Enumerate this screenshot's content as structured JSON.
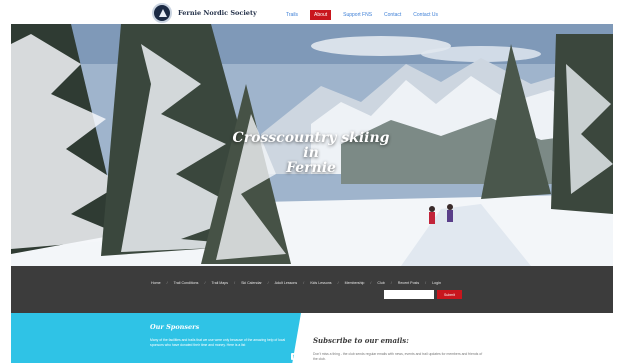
{
  "header": {
    "site_name": "Fernie Nordic Society",
    "nav": [
      {
        "label": "Trails",
        "active": false
      },
      {
        "label": "About",
        "active": true
      },
      {
        "label": "Support FNS",
        "active": false
      },
      {
        "label": "Contact",
        "active": false
      },
      {
        "label": "Contact Us",
        "active": false
      }
    ]
  },
  "hero": {
    "title_line1": "Crosscountry skiing in",
    "title_line2": "Fernie"
  },
  "menubar": {
    "links": [
      "Home",
      "Trail Conditions",
      "Trail Maps",
      "Ski Calendar",
      "Adult Lessons",
      "Kids Lessons",
      "Membership",
      "Club",
      "Recent Posts",
      "Login"
    ],
    "search_placeholder": "",
    "search_button": "Submit"
  },
  "sponsors": {
    "heading": "Our Sponsers",
    "text": "Many of the facilities and trails that we use were only because of the amazing help of local sponsors who have donated their time and money. Here is a list"
  },
  "subscribe": {
    "heading": "Subscribe to our emails:",
    "text": "Don't miss a thing - the club sends regular emails with news, events and trail updates for members and friends of the club."
  },
  "colors": {
    "accent_red": "#c8161d",
    "nav_blue": "#3d7fd6",
    "sponsor_cyan": "#2fc3e6",
    "menubar_dark": "#343434"
  }
}
